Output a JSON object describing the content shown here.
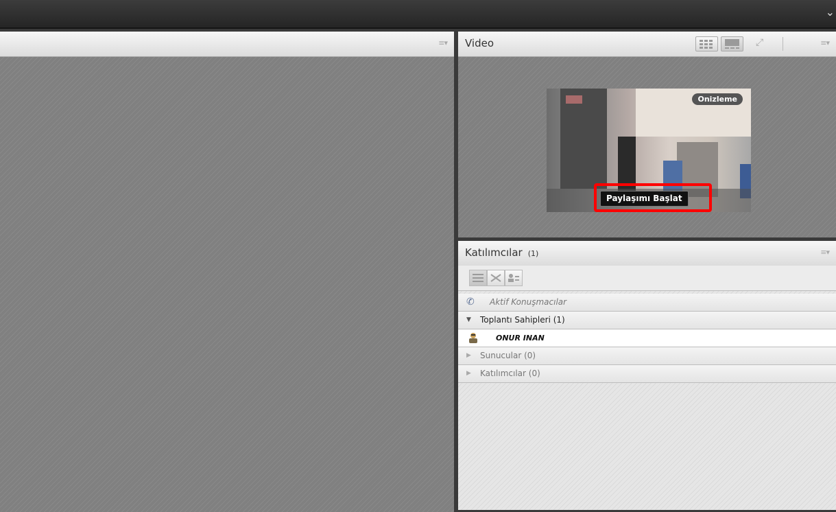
{
  "top_bar": {
    "chevron": "⌄"
  },
  "left_pod": {
    "menu_icon": "≡▾"
  },
  "video_pod": {
    "title": "Video",
    "menu_icon": "≡▾",
    "fullscreen_icon": "⤢",
    "preview_badge": "Onizleme",
    "start_share_label": "Paylaşımı Başlat",
    "highlight_color": "#ff0000"
  },
  "attendees_pod": {
    "title": "Katılımcılar",
    "count": "(1)",
    "menu_icon": "≡▾",
    "active_speakers_label": "Aktif Konuşmacılar",
    "groups": [
      {
        "label": "Toplantı Sahipleri (1)",
        "expanded": true,
        "members": [
          "ONUR INAN"
        ]
      },
      {
        "label": "Sunucular (0)",
        "expanded": false
      },
      {
        "label": "Katılımcılar (0)",
        "expanded": false
      }
    ],
    "view_buttons": [
      "list-view-icon",
      "network-view-icon",
      "user-detail-view-icon"
    ]
  }
}
